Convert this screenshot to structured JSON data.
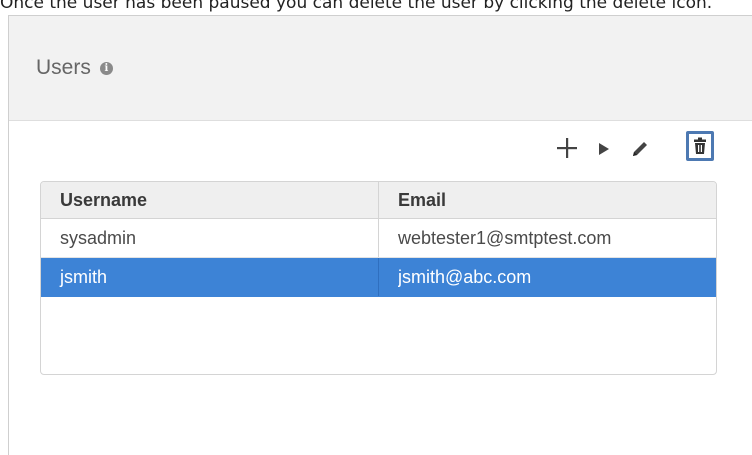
{
  "caption": "Once the user has been paused you can delete the user by clicking the delete icon.",
  "panel": {
    "title": "Users",
    "info_icon": "info-circle-icon"
  },
  "toolbar": {
    "icons": [
      "plus-icon",
      "play-icon",
      "pencil-icon",
      "trash-icon"
    ],
    "highlight_color": "#4d79b2"
  },
  "table": {
    "columns": [
      "Username",
      "Email"
    ],
    "rows": [
      {
        "username": "sysadmin",
        "email": "webtester1@smtptest.com",
        "selected": false
      },
      {
        "username": "jsmith",
        "email": "jsmith@abc.com",
        "selected": true
      }
    ],
    "selection_color": "#3d83d6"
  }
}
